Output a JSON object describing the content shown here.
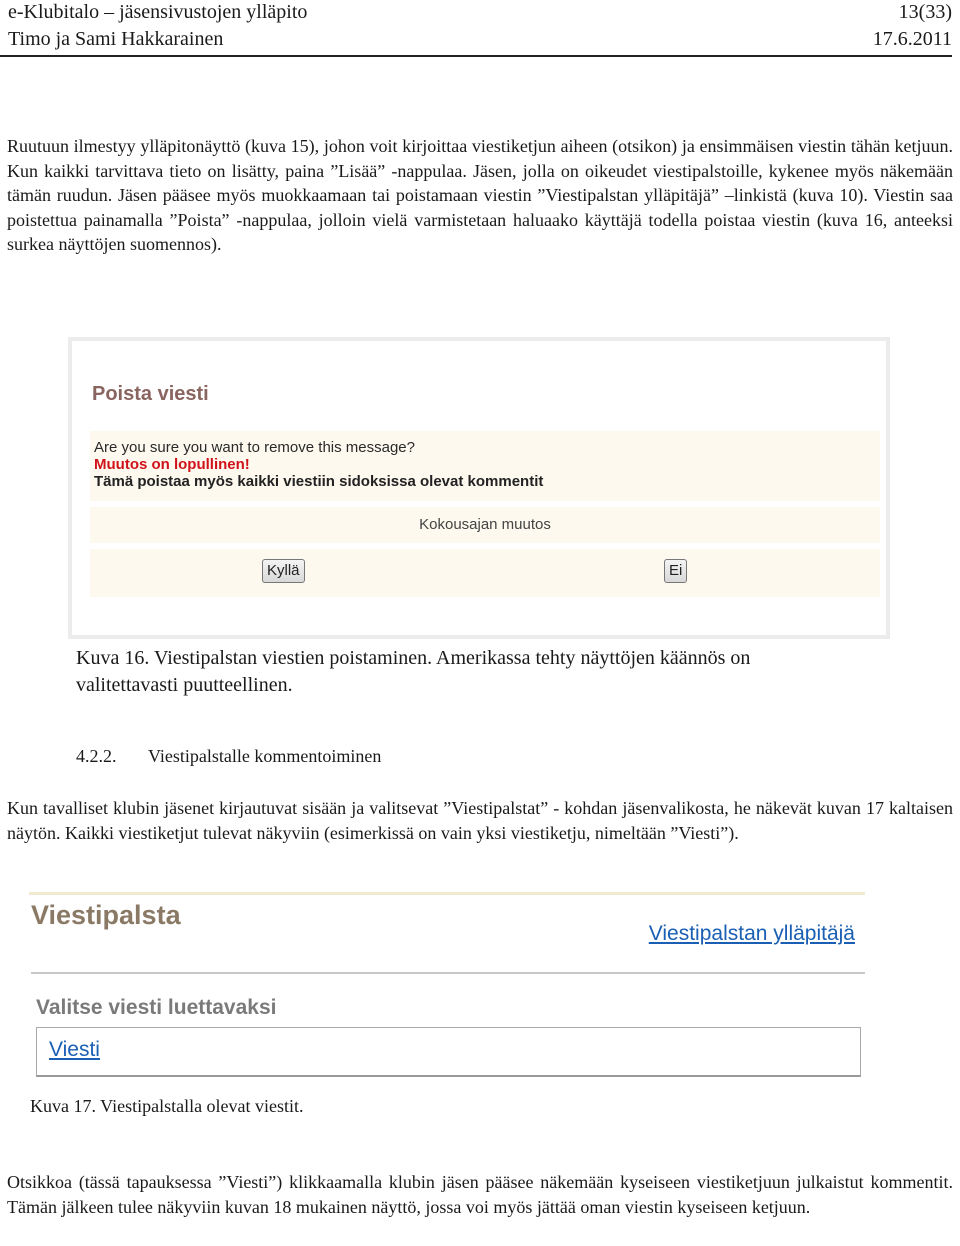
{
  "header": {
    "doc_title": "e-Klubitalo – jäsensivustojen ylläpito",
    "page": "13(33)",
    "authors": "Timo ja Sami Hakkarainen",
    "date": "17.6.2011"
  },
  "paragraph1": "Ruutuun ilmestyy ylläpitonäyttö (kuva 15), johon voit kirjoittaa viestiketjun aiheen (otsikon) ja ensimmäisen viestin tähän ketjuun. Kun kaikki tarvittava tieto on lisätty, paina ”Lisää” -nappulaa. Jäsen, jolla on oikeudet viestipalstoille, kykenee myös näkemään tämän ruudun. Jäsen pääsee myös muokkaamaan tai poistamaan viestin ”Viestipalstan ylläpitäjä” –linkistä (kuva 10). Viestin saa poistettua painamalla ”Poista” -nappulaa, jolloin vielä varmistetaan haluaako käyttäjä todella poistaa viestin (kuva 16, anteeksi surkea näyttöjen suomennos).",
  "figure16": {
    "title": "Poista viesti",
    "question": "Are you sure you want to remove this message?",
    "warning": "Muutos on lopullinen!",
    "note": "Tämä poistaa myös kaikki viestiin sidoksissa olevat kommentit",
    "message_title": "Kokousajan muutos",
    "yes_button": "Kyllä",
    "no_button": "Ei",
    "colors": {
      "title": "#8a6560",
      "warning": "#d0121a",
      "panel_bg": "#fdf9ee"
    }
  },
  "caption16_line1": "Kuva 16. Viestipalstan viestien poistaminen. Amerikassa tehty näyttöjen käännös on",
  "caption16_line2": "valitettavasti puutteellinen.",
  "section": {
    "number": "4.2.2.",
    "title": "Viestipalstalle kommentoiminen"
  },
  "paragraph2": "Kun tavalliset klubin jäsenet kirjautuvat sisään ja valitsevat ”Viestipalstat” - kohdan jäsenvalikosta, he näkevät kuvan 17 kaltaisen näytön. Kaikki viestiketjut tulevat näkyviin (esimerkissä on vain yksi viestiketju, nimeltään ”Viesti”).",
  "figure17": {
    "title": "Viestipalsta",
    "admin_link": "Viestipalstan ylläpitäjä",
    "subtitle": "Valitse viesti luettavaksi",
    "threads": [
      "Viesti"
    ],
    "colors": {
      "link": "#1a5fb4",
      "title": "#8a7a65"
    }
  },
  "caption17": "Kuva 17. Viestipalstalla olevat viestit.",
  "paragraph3": "Otsikkoa (tässä tapauksessa ”Viesti”) klikkaamalla klubin jäsen pääsee näkemään kyseiseen viestiketjuun julkaistut kommentit. Tämän jälkeen tulee näkyviin kuvan 18 mukainen näyttö, jossa voi myös jättää oman viestin kyseiseen ketjuun."
}
